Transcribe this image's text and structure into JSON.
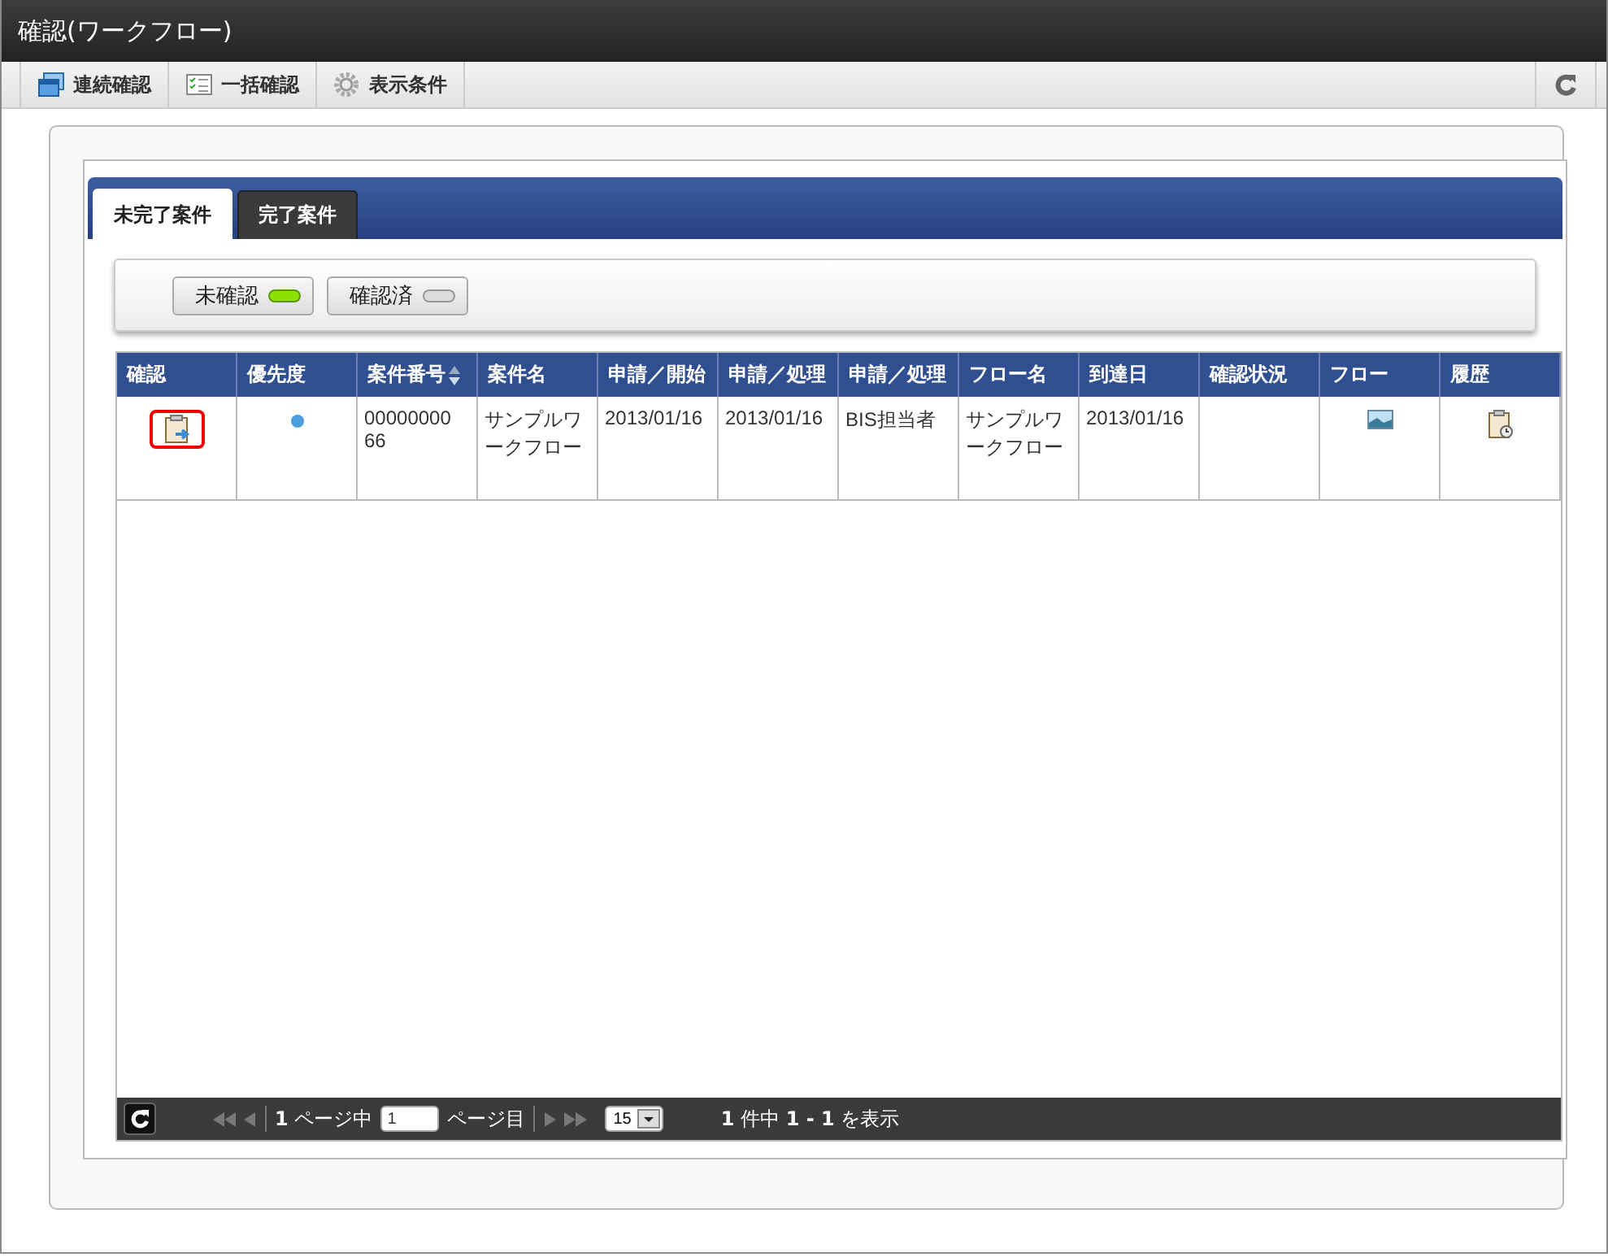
{
  "window": {
    "title": "確認(ワークフロー)"
  },
  "toolbar": [
    {
      "label": "連続確認",
      "kind": "windows"
    },
    {
      "label": "一括確認",
      "kind": "checklist"
    },
    {
      "label": "表示条件",
      "kind": "gear"
    }
  ],
  "tabs": [
    {
      "label": "未完了案件",
      "selected": true
    },
    {
      "label": "完了案件",
      "selected": false
    }
  ],
  "filters": [
    {
      "label": "未確認",
      "on": true
    },
    {
      "label": "確認済",
      "on": false
    }
  ],
  "table": {
    "columns": [
      {
        "label": "確認",
        "sortable": false
      },
      {
        "label": "優先度",
        "sortable": false
      },
      {
        "label": "案件番号",
        "sortable": true
      },
      {
        "label": "案件名",
        "sortable": false
      },
      {
        "label": "申請／開始",
        "sortable": false
      },
      {
        "label": "申請／処理",
        "sortable": false
      },
      {
        "label": "申請／処理",
        "sortable": false
      },
      {
        "label": "フロー名",
        "sortable": false
      },
      {
        "label": "到達日",
        "sortable": false
      },
      {
        "label": "確認状況",
        "sortable": false
      },
      {
        "label": "フロー",
        "sortable": false
      },
      {
        "label": "履歴",
        "sortable": false
      }
    ],
    "rows": [
      {
        "cells": [
          {
            "kind": "confirm",
            "highlighted": true
          },
          {
            "kind": "dot",
            "color": "#4a9fe0"
          },
          {
            "kind": "text",
            "text": "00000000 66"
          },
          {
            "kind": "text",
            "text": "サンプルワークフロー"
          },
          {
            "kind": "text",
            "text": "2013/01/16"
          },
          {
            "kind": "text",
            "text": "2013/01/16"
          },
          {
            "kind": "text",
            "text": "BIS担当者"
          },
          {
            "kind": "text",
            "text": "サンプルワークフロー"
          },
          {
            "kind": "text",
            "text": "2013/01/16"
          },
          {
            "kind": "empty"
          },
          {
            "kind": "flow"
          },
          {
            "kind": "history"
          }
        ]
      }
    ]
  },
  "pager": {
    "page_prefix": "**1** ページ中",
    "page_value": "1",
    "page_suffix": "ページ目",
    "per_page": "15",
    "summary": "**1** 件中 **1 - 1** を表示"
  }
}
